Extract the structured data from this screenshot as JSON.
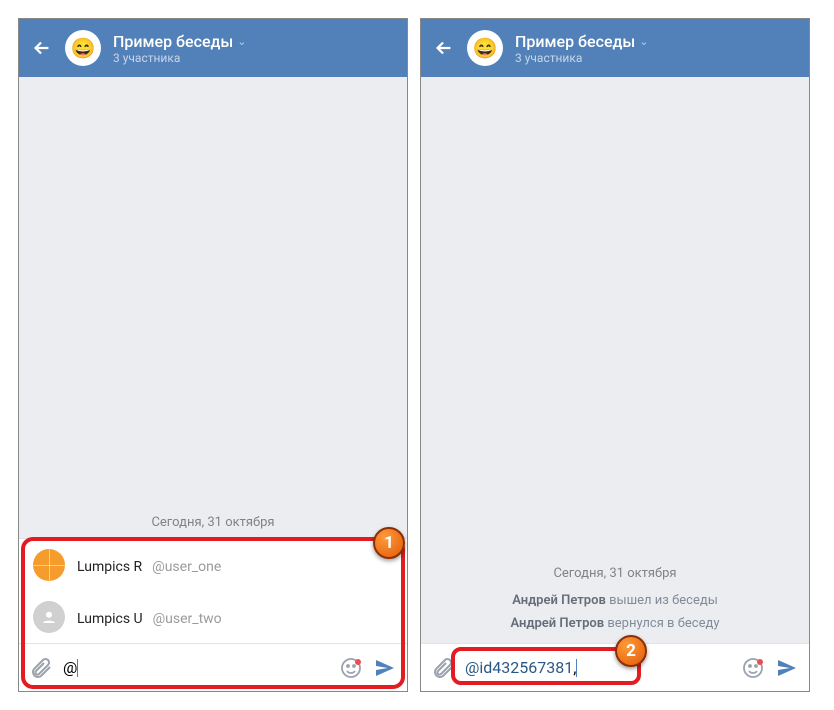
{
  "header": {
    "title": "Пример беседы",
    "subtitle": "3 участника",
    "avatar_emoji": "😄"
  },
  "left": {
    "date": "Сегодня, 31 октября",
    "suggestions": [
      {
        "name": "Lumpics R",
        "handle": "@user_one",
        "avatar_style": "orange"
      },
      {
        "name": "Lumpics U",
        "handle": "@user_two",
        "avatar_style": "grey"
      }
    ],
    "input_text": "@",
    "marker": "1"
  },
  "right": {
    "date": "Сегодня, 31 октября",
    "system_messages": [
      {
        "user": "Андрей Петров",
        "action": "вышел из беседы"
      },
      {
        "user": "Андрей Петров",
        "action": "вернулся в беседу"
      }
    ],
    "input_mention": "@id432567381",
    "input_after": ",",
    "marker": "2"
  }
}
